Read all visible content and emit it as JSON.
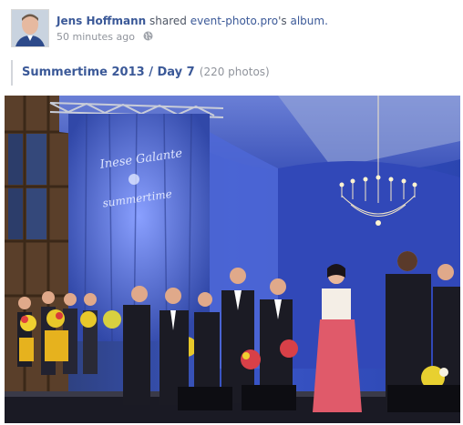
{
  "post": {
    "author": "Jens Hoffmann",
    "action": "shared",
    "page_name": "event-photo.pro",
    "possessive": "'s",
    "object": "album.",
    "time": "50 minutes ago",
    "privacy_icon": "globe-icon"
  },
  "album": {
    "title": "Summertime 2013 / Day 7",
    "count": "(220 photos)"
  },
  "photo": {
    "banner_line1": "Inese Galante",
    "banner_line2": "summertime"
  },
  "colors": {
    "link": "#3b5998",
    "muted": "#90949c",
    "stage_blue": "#3a56c8",
    "dress_pink": "#e05a6a"
  }
}
